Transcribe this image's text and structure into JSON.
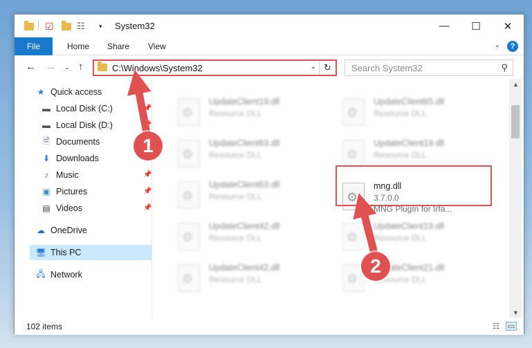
{
  "window": {
    "title": "System32",
    "minimize_glyph": "—",
    "maximize_glyph": "☐",
    "close_glyph": "✕"
  },
  "ribbon": {
    "file": "File",
    "tabs": [
      "Home",
      "Share",
      "View"
    ],
    "help": "?"
  },
  "navbar": {
    "address": "C:\\Windows\\System32",
    "search_placeholder": "Search System32"
  },
  "sidebar": {
    "items": [
      {
        "label": "Quick access",
        "icon": "star-icon"
      },
      {
        "label": "Local Disk (C:)",
        "icon": "disk-icon"
      },
      {
        "label": "Local Disk (D:)",
        "icon": "disk-icon"
      },
      {
        "label": "Documents",
        "icon": "document-icon"
      },
      {
        "label": "Downloads",
        "icon": "download-icon"
      },
      {
        "label": "Music",
        "icon": "music-icon"
      },
      {
        "label": "Pictures",
        "icon": "pictures-icon"
      },
      {
        "label": "Videos",
        "icon": "videos-icon"
      },
      {
        "label": "OneDrive",
        "icon": "cloud-icon"
      },
      {
        "label": "This PC",
        "icon": "computer-icon"
      },
      {
        "label": "Network",
        "icon": "network-icon"
      }
    ]
  },
  "files": {
    "left": [
      {
        "name": "UpdateClient19.dll",
        "type": "Resource DLL"
      },
      {
        "name": "UpdateClient63.dll",
        "type": "Resource DLL"
      },
      {
        "name": "UpdateClient63.dll",
        "type": "Resource DLL"
      },
      {
        "name": "UpdateClient42.dll",
        "type": "Resource DLL"
      },
      {
        "name": "UpdateClient42.dll",
        "type": "Resource DLL"
      }
    ],
    "right": [
      {
        "name": "UpdateClient65.dll",
        "type": "Resource DLL"
      },
      {
        "name": "UpdateClient19.dll",
        "type": "Resource DLL"
      },
      {
        "name": "UpdateClient19.dll",
        "type": "Resource DLL"
      },
      {
        "name": "UpdateClient21.dll",
        "type": "Resource DLL"
      }
    ],
    "highlighted": {
      "name": "mng.dll",
      "version": "3.7.0.0",
      "description": "MNG PlugIn for Irfa..."
    }
  },
  "status": {
    "item_count": "102 items"
  },
  "annotations": {
    "step1": "1",
    "step2": "2",
    "color": "#e05252"
  }
}
